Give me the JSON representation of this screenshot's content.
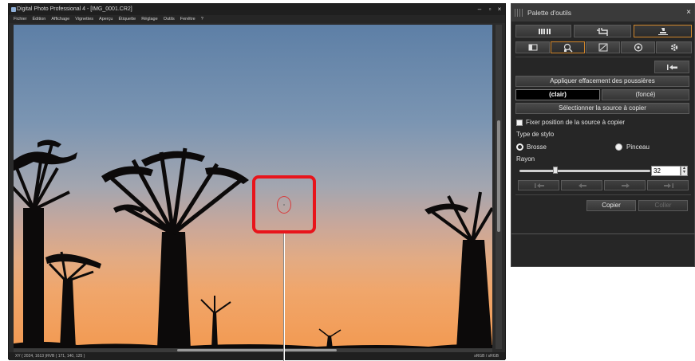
{
  "main_window": {
    "title": "Digital Photo Professional 4 - [IMG_0001.CR2]",
    "min_glyph": "–",
    "restore_glyph": "▫",
    "close_glyph": "×",
    "menu": [
      "Fichier",
      "Édition",
      "Affichage",
      "Vignettes",
      "Aperçu",
      "Étiquette",
      "Réglage",
      "Outils",
      "Fenêtre",
      "?"
    ],
    "status_left": "XY ( 2024, 1613 )RVB ( 171, 140, 125 )",
    "status_right": "sRGB / sRGB"
  },
  "palette": {
    "title": "Palette d'outils",
    "close": "×",
    "top_tabs": [
      "adjust-icon",
      "crop-icon",
      "stamp-icon"
    ],
    "sub_tabs": [
      "basic-adjust-icon",
      "dust-delete-icon",
      "tone-curve-icon",
      "color-icon",
      "settings-icon"
    ],
    "undo_all": "|⟲",
    "apply_dust": "Appliquer effacement des poussières",
    "clair": "(clair)",
    "fonce": "(foncé)",
    "select_source": "Sélectionner la source à copier",
    "fix_position": "Fixer position de la source à copier",
    "stylo_type": "Type de stylo",
    "brosse": "Brosse",
    "pinceau": "Pinceau",
    "rayon": "Rayon",
    "radius_value": "32",
    "copier": "Copier",
    "coller": "Coller"
  },
  "colors": {
    "highlight": "#e8141b",
    "accent_orange": "#d0862c"
  }
}
